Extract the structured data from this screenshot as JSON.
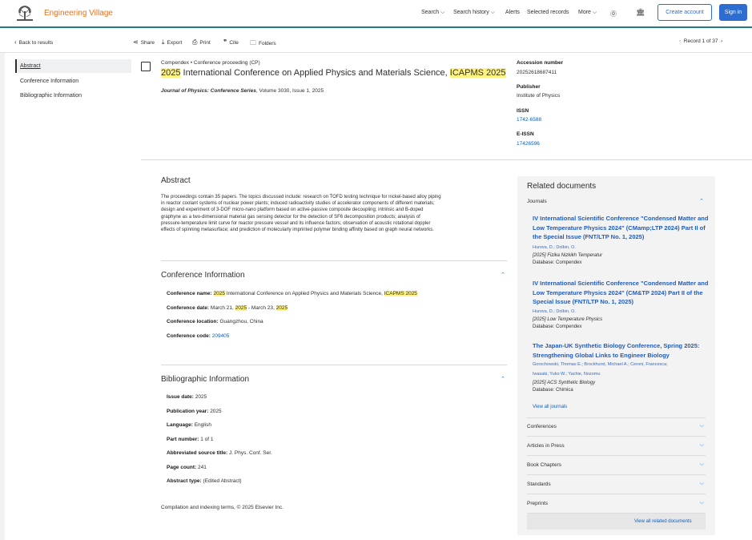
{
  "header": {
    "brand": "Engineering Village",
    "nav": [
      "Search",
      "Search history",
      "Alerts",
      "Selected records",
      "More"
    ],
    "create_account": "Create account",
    "sign_in": "Sign in"
  },
  "toolbar": {
    "back": "Back to results",
    "share": "Share",
    "export": "Export",
    "print": "Print",
    "cite": "Cite",
    "folders": "Folders",
    "record": "Record 1 of 37"
  },
  "leftnav": [
    "Abstract",
    "Conference Information",
    "Bibliographic Information"
  ],
  "record": {
    "source_line": "Compendex  •  Conference proceeding (CP)",
    "title_a": "2025",
    "title_b": " International Conference on Applied Physics and Materials Science, ",
    "title_c": "ICAPMS 2025",
    "journal": "Journal of Physics: Conference Series",
    "journal_rest": ", Volume 3030, Issue 1, 2025"
  },
  "meta": {
    "accession_label": "Accession number",
    "accession": "20252618687411",
    "publisher_label": "Publisher",
    "publisher": "Institute of Physics",
    "issn_label": "ISSN",
    "issn": "1742-6588",
    "eissn_label": "E-ISSN",
    "eissn": "17426596"
  },
  "abstract": {
    "heading": "Abstract",
    "lines": [
      "The proceedings contain 35 papers. The topics discussed include: research on TOFD testing technique for nickel-based alloy piping",
      "in reactor coolant systems of nuclear power plants; induced radioactivity studies of accelerator components of different materials;",
      "design and experiment of 3-DOF micro-nano platform based on active-passive composite decoupling; intrinsic and B-doped",
      "graphyne as a two-dimensional material gas sensing detector for the detection of SF6 decomposition products; analysis of",
      "pressure-temperature limit curve for reactor pressure vessel and its influence factors; observation of acoustic rotational doppler",
      "effects of spinning metasurface; and prediction of molecularly imprinted polymer binding affinity based on graph neural networks."
    ]
  },
  "conference": {
    "heading": "Conference Information",
    "name_label": "Conference name:",
    "name_a": "2025",
    "name_b": " International Conference on Applied Physics and Materials Science, ",
    "name_c": "ICAPMS 2025",
    "date_label": "Conference date:",
    "date_a": "March 21, ",
    "date_b": "2025",
    "date_c": " - March 23, ",
    "date_d": "2025",
    "location_label": "Conference location:",
    "location": "Guangzhou, China",
    "code_label": "Conference code:",
    "code": "209405"
  },
  "biblio": {
    "heading": "Bibliographic Information",
    "rows": [
      {
        "label": "Issue date:",
        "value": "2025"
      },
      {
        "label": "Publication year:",
        "value": "2025"
      },
      {
        "label": "Language:",
        "value": "English"
      },
      {
        "label": "Part number:",
        "value": "1 of 1"
      },
      {
        "label": "Abbreviated source title:",
        "value": "J. Phys. Conf. Ser."
      },
      {
        "label": "Page count:",
        "value": "241"
      },
      {
        "label": "Abstract type:",
        "value": "(Edited Abstract)"
      }
    ]
  },
  "footer": "Compilation and indexing terms, © 2025 Elsevier Inc.",
  "related": {
    "heading": "Related documents",
    "journals_label": "Journals",
    "docs": [
      {
        "title": "IV International Scientific Conference \"Condensed Matter and Low Temperature Physics 2024\" (CMamp;LTP 2024) Part II of the Special Issue (FNT/LTP No. 1, 2025)",
        "authors": "Hurova, D.;  Dolbin, O.",
        "source": "[2025] Fizika Nizkikh Temperatur",
        "db": "Database: Compendex"
      },
      {
        "title": "IV International Scientific Conference \"Condensed Matter and Low Temperature Physics 2024\" (CM&TP 2024) Part II of the Special Issue (FNT/LTP No. 1, 2025)",
        "authors": "Hurova, D.;  Dolbin, O.",
        "source": "[2025] Low Temperature Physics",
        "db": "Database: Compendex"
      },
      {
        "title": "The Japan-UK Synthetic Biology Conference, Spring 2025: Strengthening Global Links to Engineer Biology",
        "authors": "Gorochowski, Thomas E.;  Brockhurst, Michael A.;  Ceroni, Francesca;",
        "authors2": "Iwasaki, Yuko W.;  Yachie, Nozomu",
        "source": "[2025] ACS Synthetic Biology",
        "db": "Database: Chimica"
      }
    ],
    "view_journals": "View all journals",
    "categories": [
      "Conferences",
      "Articles in Press",
      "Book Chapters",
      "Standards",
      "Preprints"
    ],
    "view_all": "View all related documents"
  }
}
